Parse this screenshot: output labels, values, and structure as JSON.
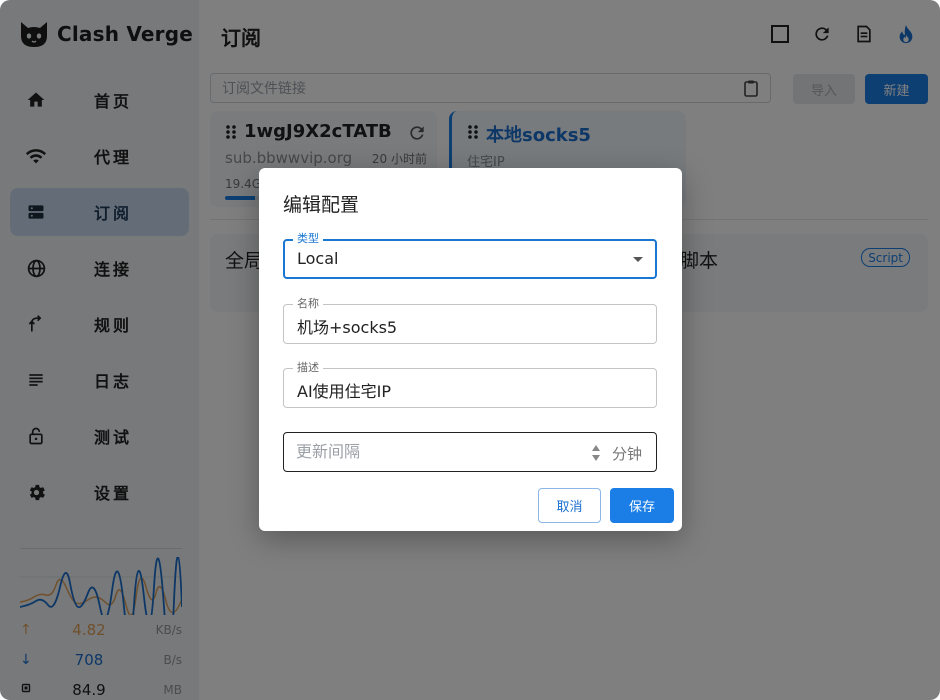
{
  "app": {
    "name": "Clash Verge",
    "accent_color": "#1a7ee6"
  },
  "sidebar": {
    "items": [
      {
        "label": "首页",
        "icon": "home-icon"
      },
      {
        "label": "代理",
        "icon": "wifi-icon"
      },
      {
        "label": "订阅",
        "icon": "server-icon",
        "active": true
      },
      {
        "label": "连接",
        "icon": "globe-icon"
      },
      {
        "label": "规则",
        "icon": "route-icon"
      },
      {
        "label": "日志",
        "icon": "list-icon"
      },
      {
        "label": "测试",
        "icon": "lock-icon"
      },
      {
        "label": "设置",
        "icon": "gear-icon"
      }
    ]
  },
  "traffic": {
    "up_value": "4.82",
    "up_unit": "KB/s",
    "down_value": "708",
    "down_unit": "B/s",
    "mem_value": "84.9",
    "mem_unit": "MB",
    "up_color": "#e0a15a",
    "down_color": "#1a6fce"
  },
  "header": {
    "title": "订阅",
    "icons": [
      "square-icon",
      "refresh-icon",
      "document-icon",
      "fire-icon"
    ]
  },
  "url_bar": {
    "placeholder": "订阅文件链接",
    "import_label": "导入",
    "new_label": "新建"
  },
  "profiles": [
    {
      "name": "1wgJ9X2cTATB",
      "subtitle": "sub.bbwwvip.org",
      "updated": "20 小时前",
      "usage": "19.4G",
      "progress": 0.15
    },
    {
      "name": "本地socks5",
      "subtitle": "住宅IP",
      "selected": true
    }
  ],
  "extra_cards": {
    "left_text": "全局",
    "right_text": "脚本",
    "badge": "Script"
  },
  "dialog": {
    "title": "编辑配置",
    "type_label": "类型",
    "type_value": "Local",
    "name_label": "名称",
    "name_value": "机场+socks5",
    "desc_label": "描述",
    "desc_value": "AI使用住宅IP",
    "interval_placeholder": "更新间隔",
    "interval_unit": "分钟",
    "cancel_label": "取消",
    "save_label": "保存"
  }
}
